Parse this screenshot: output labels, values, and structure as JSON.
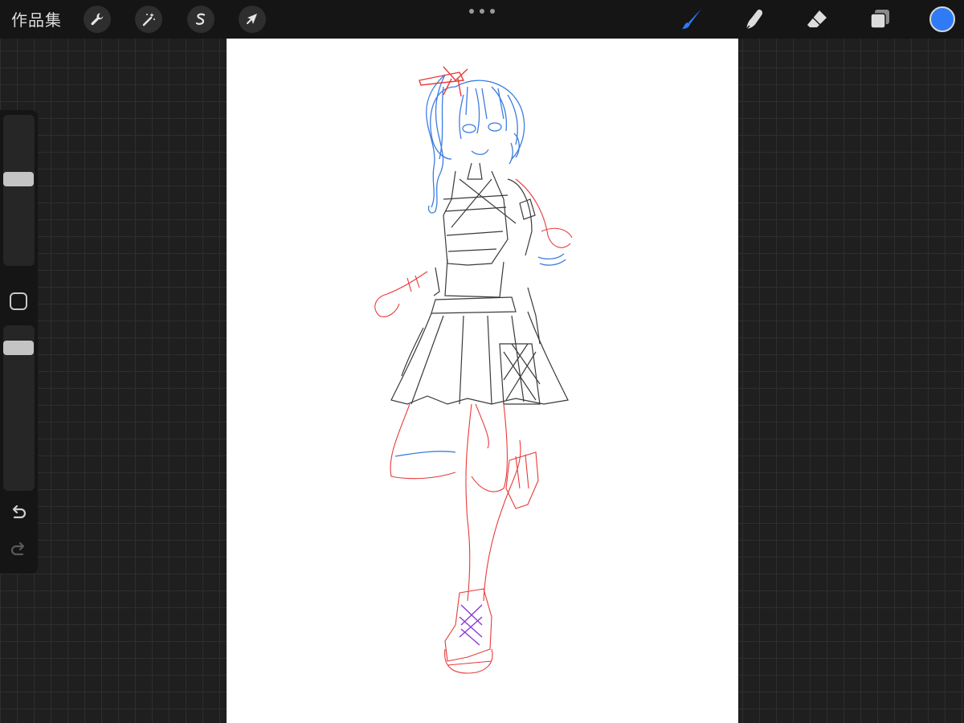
{
  "topbar": {
    "gallery_label": "作品集",
    "left_tools": [
      {
        "name": "actions",
        "icon": "wrench-icon"
      },
      {
        "name": "adjustments",
        "icon": "magic-wand-icon"
      },
      {
        "name": "selection",
        "icon": "selection-s-icon"
      },
      {
        "name": "transform",
        "icon": "arrow-cursor-icon"
      }
    ],
    "more_icon": "more-dots-icon",
    "right_tools": [
      {
        "name": "brush",
        "icon": "brush-icon",
        "active": true
      },
      {
        "name": "smudge",
        "icon": "smudge-finger-icon",
        "active": false
      },
      {
        "name": "eraser",
        "icon": "eraser-icon",
        "active": false
      },
      {
        "name": "layers",
        "icon": "layers-icon",
        "active": false
      }
    ],
    "current_color": "#2f7bf5",
    "active_tool_color": "#2f7bf5"
  },
  "sidebar": {
    "brush_size_level": 0.58,
    "opacity_level": 0.9,
    "modify_icon": "square-modify-icon",
    "undo_icon": "undo-icon",
    "redo_icon": "redo-icon"
  },
  "canvas": {
    "background": "#ffffff",
    "sketch_colors": {
      "lineart": "#3a3a3a",
      "hair": "#3d7de0",
      "rough": "#e83a3a",
      "laces": "#8a3ad8"
    }
  }
}
